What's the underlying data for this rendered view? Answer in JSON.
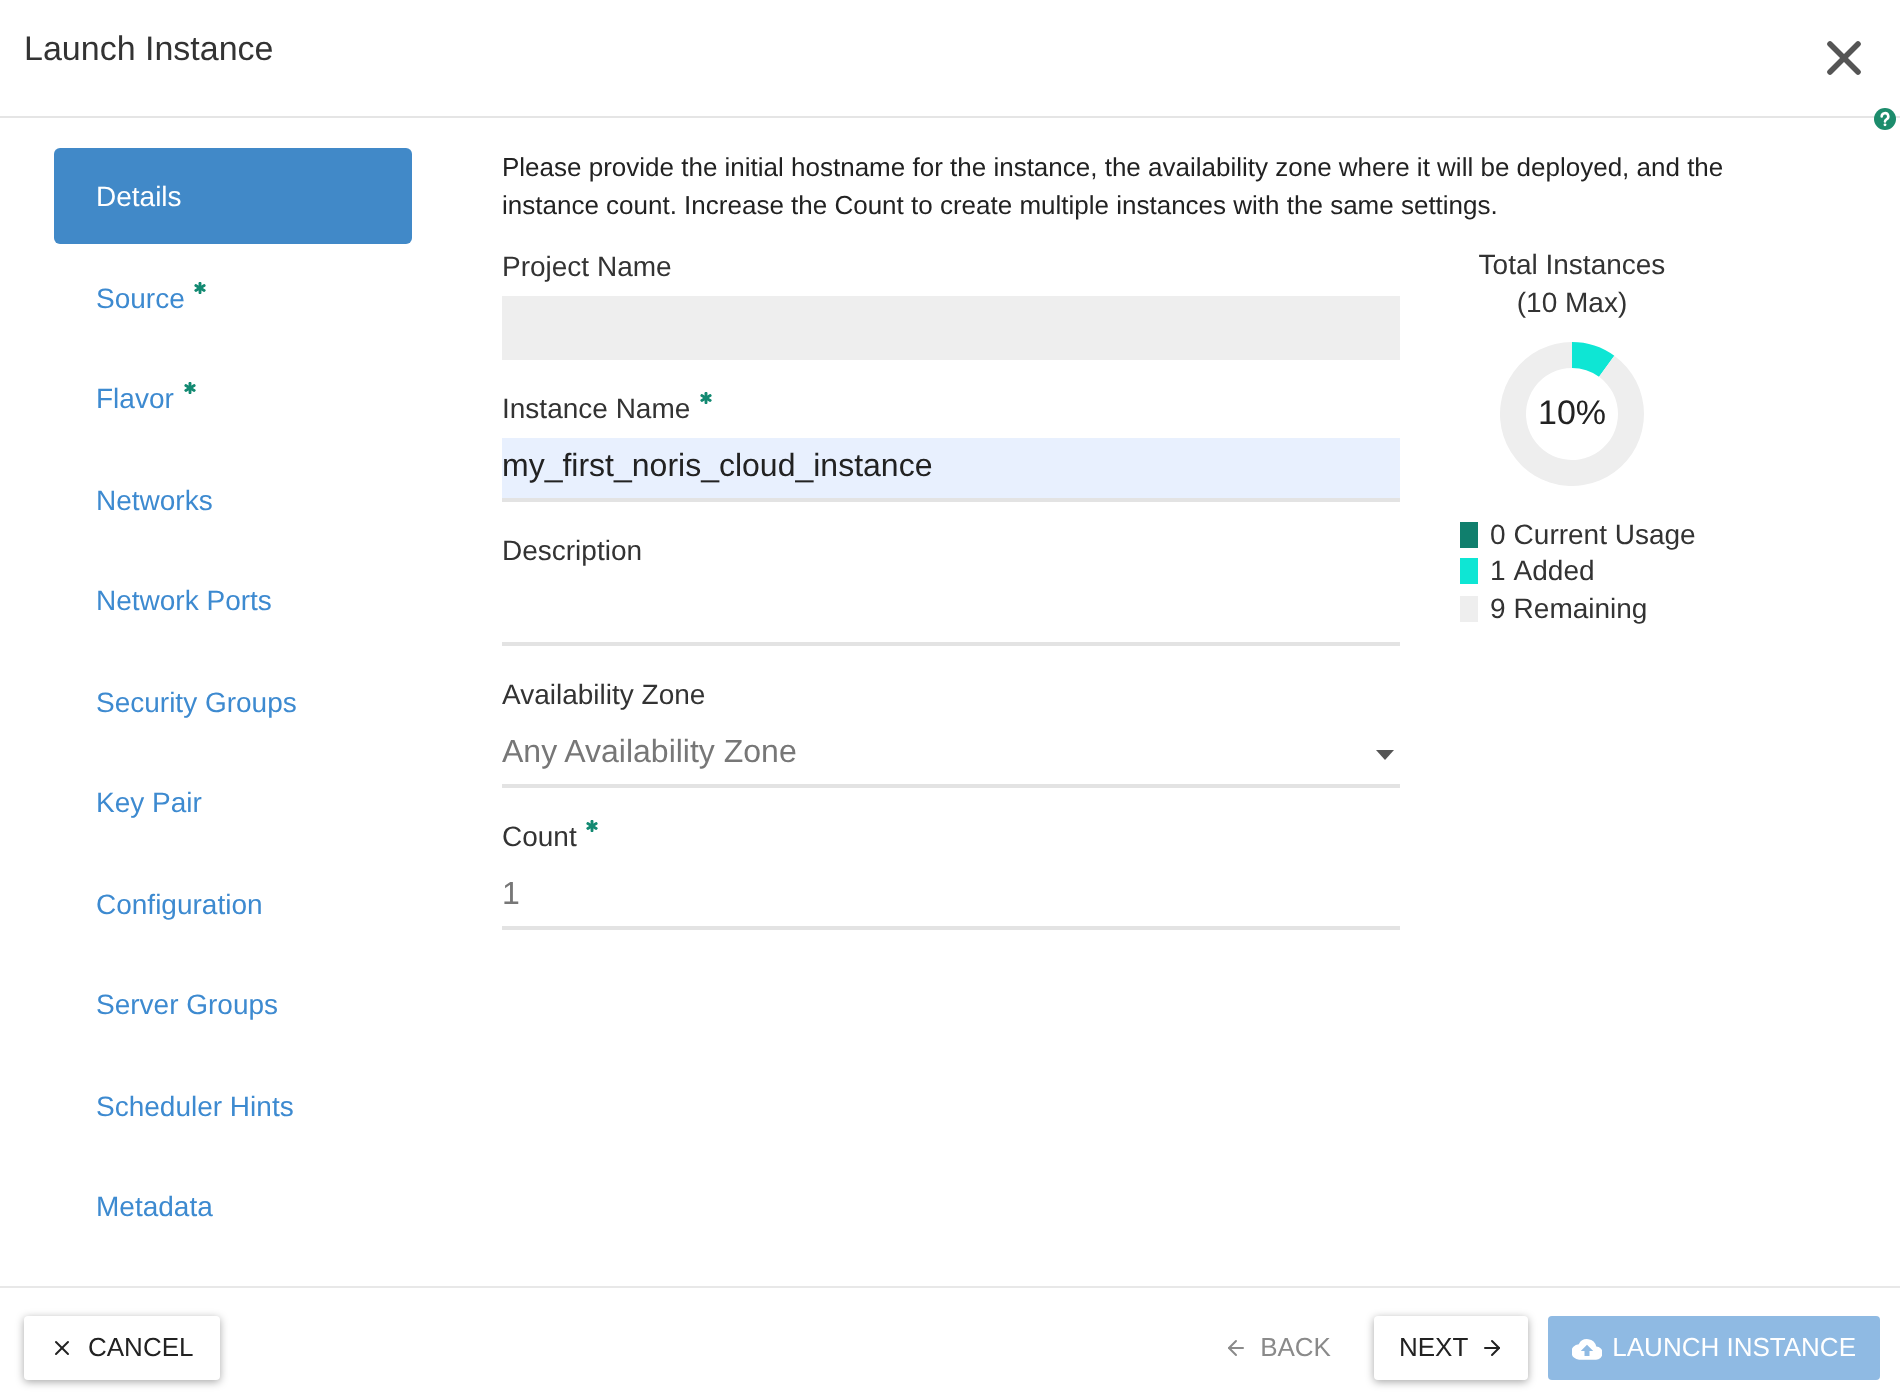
{
  "dialog": {
    "title": "Launch Instance"
  },
  "sidebar": {
    "items": [
      {
        "label": "Details",
        "selected": true,
        "required": false
      },
      {
        "label": "Source",
        "selected": false,
        "required": true
      },
      {
        "label": "Flavor",
        "selected": false,
        "required": true
      },
      {
        "label": "Networks",
        "selected": false,
        "required": false
      },
      {
        "label": "Network Ports",
        "selected": false,
        "required": false
      },
      {
        "label": "Security Groups",
        "selected": false,
        "required": false
      },
      {
        "label": "Key Pair",
        "selected": false,
        "required": false
      },
      {
        "label": "Configuration",
        "selected": false,
        "required": false
      },
      {
        "label": "Server Groups",
        "selected": false,
        "required": false
      },
      {
        "label": "Scheduler Hints",
        "selected": false,
        "required": false
      },
      {
        "label": "Metadata",
        "selected": false,
        "required": false
      }
    ]
  },
  "details": {
    "intro": "Please provide the initial hostname for the instance, the availability zone where it will be deployed, and the instance count. Increase the Count to create multiple instances with the same settings.",
    "fields": [
      {
        "kind": "text",
        "label": "Project Name",
        "required": false,
        "disabled": true,
        "autofilled": false
      },
      {
        "kind": "text",
        "label": "Instance Name",
        "required": true,
        "disabled": false,
        "autofilled": true,
        "value": "my_first_noris_cloud_instance"
      },
      {
        "kind": "textarea",
        "label": "Description",
        "required": false,
        "disabled": false,
        "autofilled": false
      },
      {
        "kind": "select",
        "label": "Availability Zone",
        "required": false,
        "disabled": false,
        "autofilled": false,
        "value": "Any Availability Zone"
      },
      {
        "kind": "number",
        "label": "Count",
        "required": true,
        "disabled": false,
        "autofilled": false,
        "value": "1"
      }
    ]
  },
  "instances": {
    "subtitle": "(10 Max)",
    "center_label": "10%",
    "chart_data": {
      "type": "donut",
      "title": "Total Instances",
      "categories": [
        "Current Usage",
        "Added",
        "Remaining"
      ],
      "values": [
        0,
        1,
        9
      ],
      "value_labels": [
        "0",
        "1",
        "9"
      ],
      "colors": [
        "#107f6d",
        "#0ee6d4",
        "#eeeeee"
      ],
      "legend": "bottom"
    }
  },
  "footer": {
    "buttons": [
      {
        "kind": "cancel",
        "label": "CANCEL",
        "disabled": false
      },
      {
        "kind": "back",
        "label": "BACK",
        "disabled": true
      },
      {
        "kind": "next",
        "label": "NEXT",
        "disabled": false
      },
      {
        "kind": "launch",
        "label": "LAUNCH INSTANCE",
        "disabled": true
      }
    ]
  }
}
